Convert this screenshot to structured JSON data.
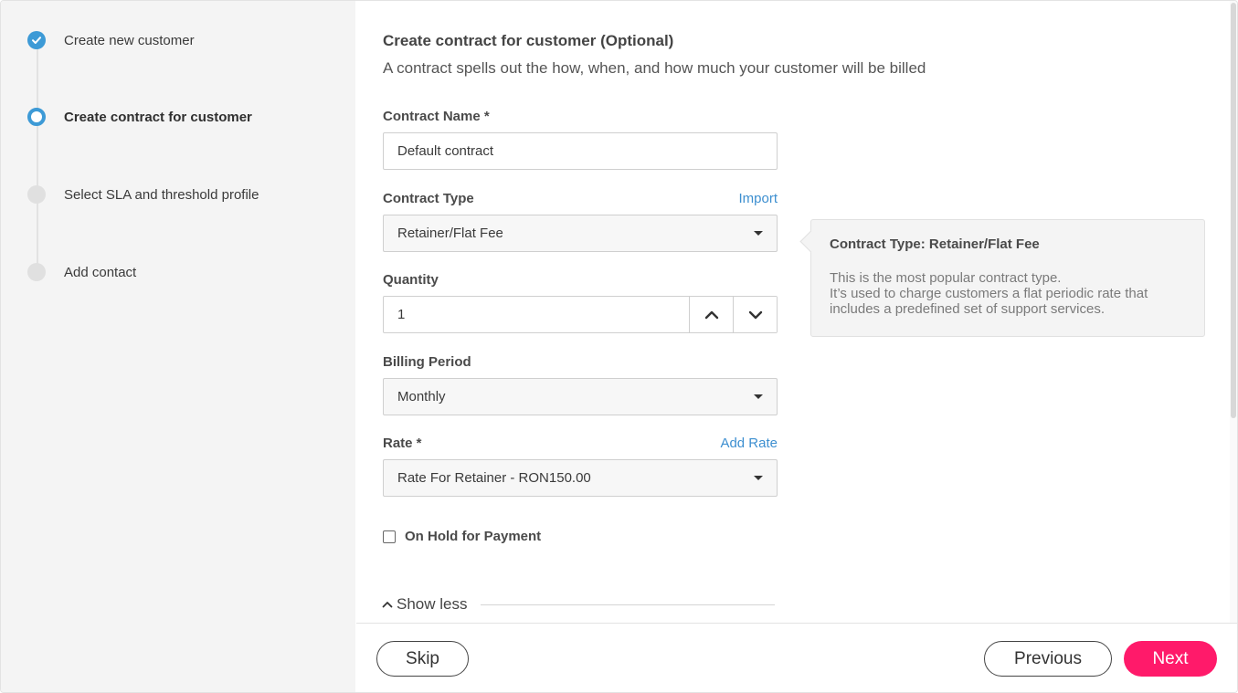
{
  "stepper": {
    "steps": [
      {
        "label": "Create new customer",
        "state": "done"
      },
      {
        "label": "Create contract for customer",
        "state": "current"
      },
      {
        "label": "Select SLA and threshold profile",
        "state": "pending"
      },
      {
        "label": "Add contact",
        "state": "pending"
      }
    ]
  },
  "form": {
    "title": "Create contract for customer (Optional)",
    "subtitle": "A contract spells out the how, when, and how much your customer will be billed",
    "contract_name": {
      "label": "Contract Name *",
      "value": "Default contract"
    },
    "contract_type": {
      "label": "Contract Type",
      "link": "Import",
      "value": "Retainer/Flat Fee"
    },
    "quantity": {
      "label": "Quantity",
      "value": "1"
    },
    "billing_period": {
      "label": "Billing Period",
      "value": "Monthly"
    },
    "rate": {
      "label": "Rate *",
      "link": "Add Rate",
      "value": "Rate For Retainer - RON150.00"
    },
    "on_hold": {
      "label": "On Hold for Payment",
      "checked": false
    },
    "show_less": "Show less"
  },
  "tooltip": {
    "title": "Contract Type: Retainer/Flat Fee",
    "line1": "This is the most popular contract type.",
    "line2": "It’s used to charge customers a flat periodic rate that",
    "line3": "includes a predefined set of support services."
  },
  "footer": {
    "skip": "Skip",
    "previous": "Previous",
    "next": "Next"
  },
  "colors": {
    "accent_blue": "#3d9ad6",
    "primary_pink": "#ff1a6a",
    "link_blue": "#3d8fd0"
  }
}
